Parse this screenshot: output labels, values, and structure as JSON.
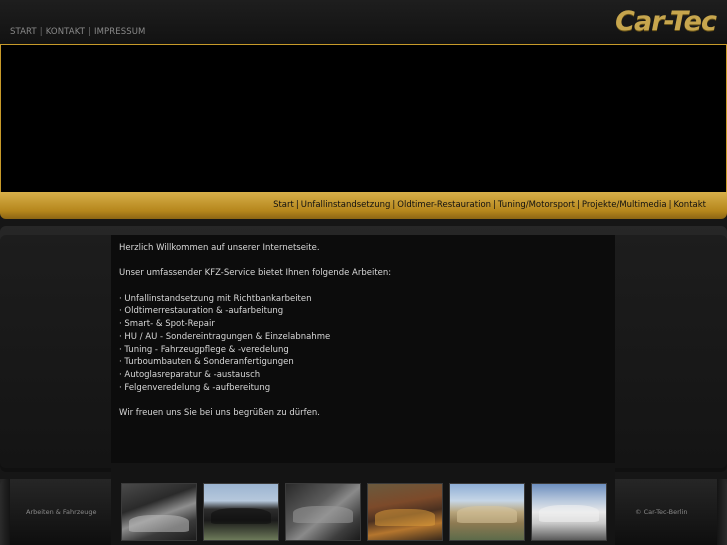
{
  "top_nav": {
    "items": [
      "START",
      "KONTAKT",
      "IMPRESSUM"
    ],
    "separator": "|"
  },
  "logo": {
    "text": "Car-Tec",
    "color": "#c7a64e"
  },
  "main_nav": {
    "items": [
      "Start",
      "Unfallinstandsetzung",
      "Oldtimer-Restauration",
      "Tuning/Motorsport",
      "Projekte/Multimedia",
      "Kontakt"
    ],
    "separator": "|"
  },
  "content": {
    "welcome": "Herzlich Willkommen auf unserer Internetseite.",
    "intro": "Unser umfassender KFZ-Service bietet Ihnen folgende Arbeiten:",
    "services": [
      "· Unfallinstandsetzung mit Richtbankarbeiten",
      "· Oldtimerrestauration & -aufarbeitung",
      "· Smart- & Spot-Repair",
      "· HU / AU - Sondereintragungen & Einzelabnahme",
      "· Tuning - Fahrzeugpflege & -veredelung",
      "· Turboumbauten & Sonderanfertigungen",
      "· Autoglasreparatur & -austausch",
      "· Felgenveredelung & -aufbereitung"
    ],
    "closing": "Wir freuen uns Sie bei uns begrüßen zu dürfen."
  },
  "gallery": {
    "label": "Arbeiten & Fahrzeuge",
    "copyright": "© Car-Tec-Berlin",
    "thumbnails": [
      "car-photo-1",
      "car-photo-2",
      "car-photo-3",
      "car-photo-4",
      "car-photo-5",
      "car-photo-6"
    ]
  },
  "colors": {
    "accent_gold": "#c79a2a",
    "background": "#161616"
  }
}
